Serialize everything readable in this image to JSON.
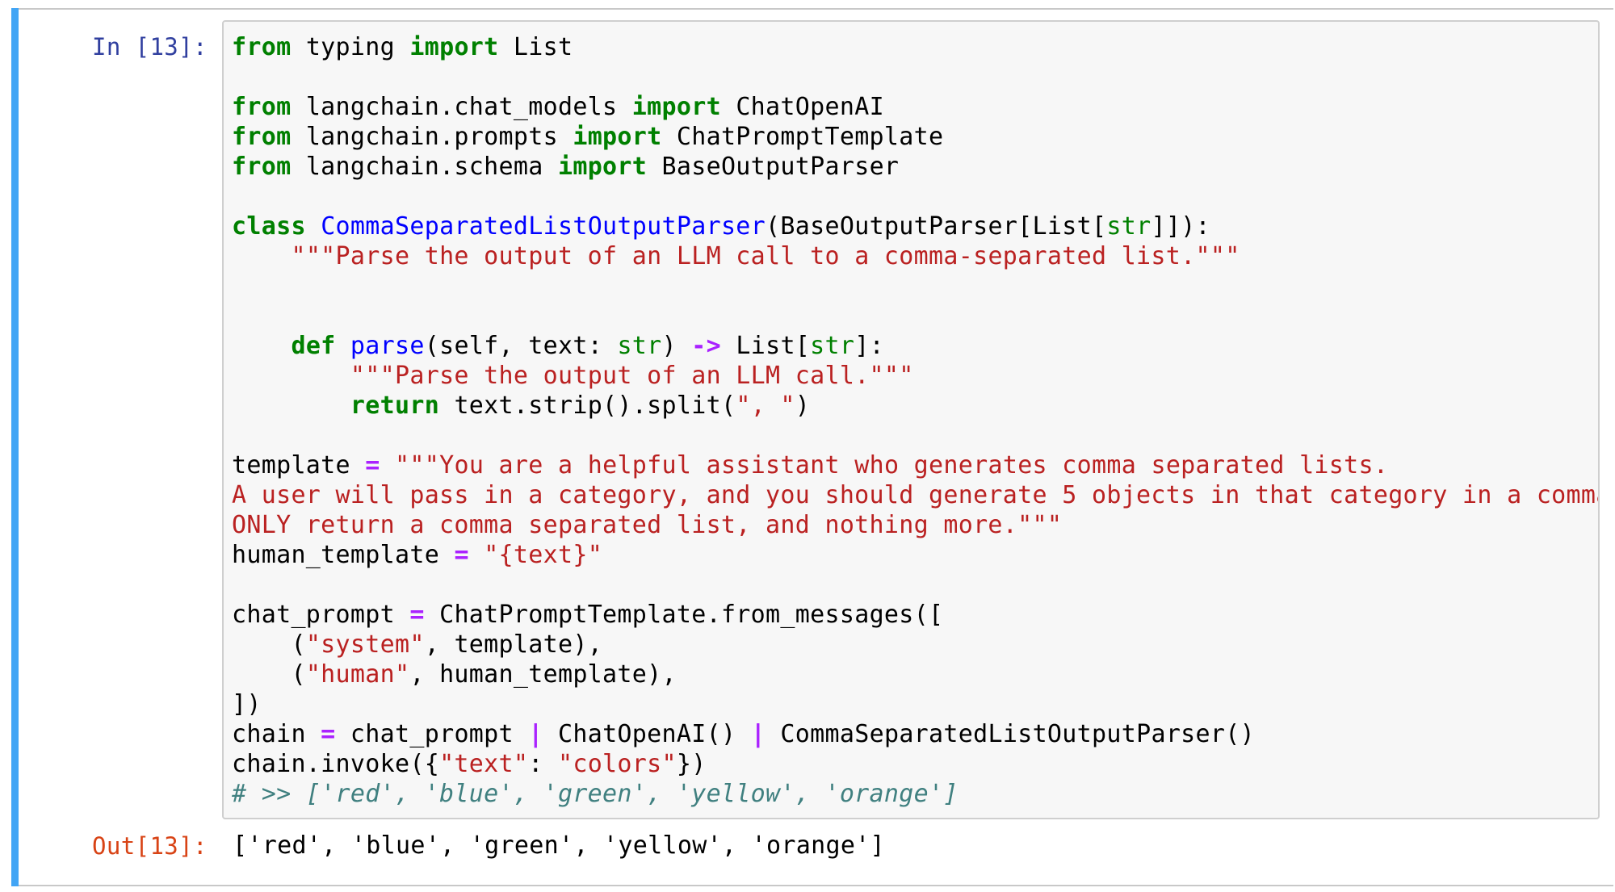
{
  "cell": {
    "in_prompt": "In [13]:",
    "out_prompt": "Out[13]:",
    "output_text": "['red', 'blue', 'green', 'yellow', 'orange']",
    "code_lines": [
      [
        {
          "t": "from",
          "c": "kw"
        },
        {
          "t": " typing ",
          "c": ""
        },
        {
          "t": "import",
          "c": "kw"
        },
        {
          "t": " List",
          "c": ""
        }
      ],
      [],
      [
        {
          "t": "from",
          "c": "kw"
        },
        {
          "t": " langchain.chat_models ",
          "c": ""
        },
        {
          "t": "import",
          "c": "kw"
        },
        {
          "t": " ChatOpenAI",
          "c": ""
        }
      ],
      [
        {
          "t": "from",
          "c": "kw"
        },
        {
          "t": " langchain.prompts ",
          "c": ""
        },
        {
          "t": "import",
          "c": "kw"
        },
        {
          "t": " ChatPromptTemplate",
          "c": ""
        }
      ],
      [
        {
          "t": "from",
          "c": "kw"
        },
        {
          "t": " langchain.schema ",
          "c": ""
        },
        {
          "t": "import",
          "c": "kw"
        },
        {
          "t": " BaseOutputParser",
          "c": ""
        }
      ],
      [],
      [
        {
          "t": "class",
          "c": "kw"
        },
        {
          "t": " ",
          "c": ""
        },
        {
          "t": "CommaSeparatedListOutputParser",
          "c": "cls"
        },
        {
          "t": "(BaseOutputParser[List[",
          "c": ""
        },
        {
          "t": "str",
          "c": "bi"
        },
        {
          "t": "]]):",
          "c": ""
        }
      ],
      [
        {
          "t": "    ",
          "c": ""
        },
        {
          "t": "\"\"\"Parse the output of an LLM call to a comma-separated list.\"\"\"",
          "c": "str"
        }
      ],
      [],
      [],
      [
        {
          "t": "    ",
          "c": ""
        },
        {
          "t": "def",
          "c": "kw"
        },
        {
          "t": " ",
          "c": ""
        },
        {
          "t": "parse",
          "c": "fn"
        },
        {
          "t": "(self, text: ",
          "c": ""
        },
        {
          "t": "str",
          "c": "bi"
        },
        {
          "t": ") ",
          "c": ""
        },
        {
          "t": "->",
          "c": "op"
        },
        {
          "t": " List[",
          "c": ""
        },
        {
          "t": "str",
          "c": "bi"
        },
        {
          "t": "]:",
          "c": ""
        }
      ],
      [
        {
          "t": "        ",
          "c": ""
        },
        {
          "t": "\"\"\"Parse the output of an LLM call.\"\"\"",
          "c": "str"
        }
      ],
      [
        {
          "t": "        ",
          "c": ""
        },
        {
          "t": "return",
          "c": "kw"
        },
        {
          "t": " text.strip().split(",
          "c": ""
        },
        {
          "t": "\", \"",
          "c": "str"
        },
        {
          "t": ")",
          "c": ""
        }
      ],
      [],
      [
        {
          "t": "template ",
          "c": ""
        },
        {
          "t": "=",
          "c": "op"
        },
        {
          "t": " ",
          "c": ""
        },
        {
          "t": "\"\"\"You are a helpful assistant who generates comma separated lists.",
          "c": "str"
        }
      ],
      [
        {
          "t": "A user will pass in a category, and you should generate 5 objects in that category in a comma",
          "c": "str"
        }
      ],
      [
        {
          "t": "ONLY return a comma separated list, and nothing more.\"\"\"",
          "c": "str"
        }
      ],
      [
        {
          "t": "human_template ",
          "c": ""
        },
        {
          "t": "=",
          "c": "op"
        },
        {
          "t": " ",
          "c": ""
        },
        {
          "t": "\"{text}\"",
          "c": "str"
        }
      ],
      [],
      [
        {
          "t": "chat_prompt ",
          "c": ""
        },
        {
          "t": "=",
          "c": "op"
        },
        {
          "t": " ChatPromptTemplate.from_messages([",
          "c": ""
        }
      ],
      [
        {
          "t": "    (",
          "c": ""
        },
        {
          "t": "\"system\"",
          "c": "str"
        },
        {
          "t": ", template),",
          "c": ""
        }
      ],
      [
        {
          "t": "    (",
          "c": ""
        },
        {
          "t": "\"human\"",
          "c": "str"
        },
        {
          "t": ", human_template),",
          "c": ""
        }
      ],
      [
        {
          "t": "])",
          "c": ""
        }
      ],
      [
        {
          "t": "chain ",
          "c": ""
        },
        {
          "t": "=",
          "c": "op"
        },
        {
          "t": " chat_prompt ",
          "c": ""
        },
        {
          "t": "|",
          "c": "op"
        },
        {
          "t": " ChatOpenAI() ",
          "c": ""
        },
        {
          "t": "|",
          "c": "op"
        },
        {
          "t": " CommaSeparatedListOutputParser()",
          "c": ""
        }
      ],
      [
        {
          "t": "chain.invoke({",
          "c": ""
        },
        {
          "t": "\"text\"",
          "c": "str"
        },
        {
          "t": ": ",
          "c": ""
        },
        {
          "t": "\"colors\"",
          "c": "str"
        },
        {
          "t": "})",
          "c": ""
        }
      ],
      [
        {
          "t": "# >> ['red', 'blue', 'green', 'yellow', 'orange']",
          "c": "cm"
        }
      ]
    ]
  },
  "colors": {
    "cell_marker": "#42a5f5",
    "in_prompt": "#303f9f",
    "out_prompt": "#d84315",
    "keyword": "#008000",
    "class_name": "#0000ff",
    "string": "#ba2121",
    "operator": "#aa22ff",
    "comment": "#408080",
    "input_bg": "#f7f7f7"
  }
}
